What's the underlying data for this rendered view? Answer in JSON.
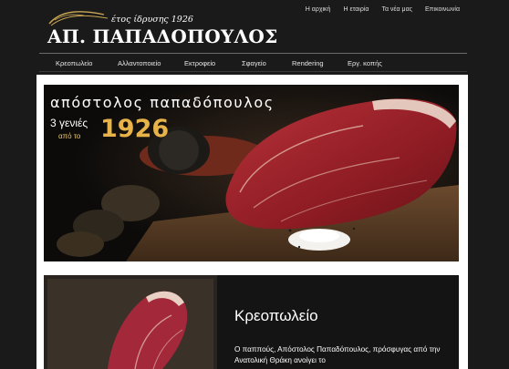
{
  "brand": {
    "established": "έτος ίδρυσης 1926",
    "name": "ΑΠ. ΠΑΠΑΔΟΠΟΥΛΟΣ"
  },
  "topnav": [
    {
      "label": "Η αρχική"
    },
    {
      "label": "Η εταιρία"
    },
    {
      "label": "Τα νέα μας"
    },
    {
      "label": "Επικοινωνία"
    }
  ],
  "menu": [
    {
      "label": "Κρεοπωλείο"
    },
    {
      "label": "Αλλαντοποιείο"
    },
    {
      "label": "Εκτροφείο"
    },
    {
      "label": "Σφαγείο"
    },
    {
      "label": "Rendering"
    },
    {
      "label": "Εργ. κοπής"
    }
  ],
  "banner": {
    "title": "απόστολος παπαδόπουλος",
    "generations": "3 γενιές",
    "since": "από το",
    "year": "1926"
  },
  "section": {
    "title": "Κρεοπωλείο",
    "text": "Ο παππούς, Απόστολος Παπαδόπουλος, πρόσφυγας από την Ανατολική Θράκη ανοίγει το"
  },
  "colors": {
    "page_background": "#1a1a1a",
    "content_background": "#ffffff",
    "accent_gold": "#e8b44a"
  }
}
